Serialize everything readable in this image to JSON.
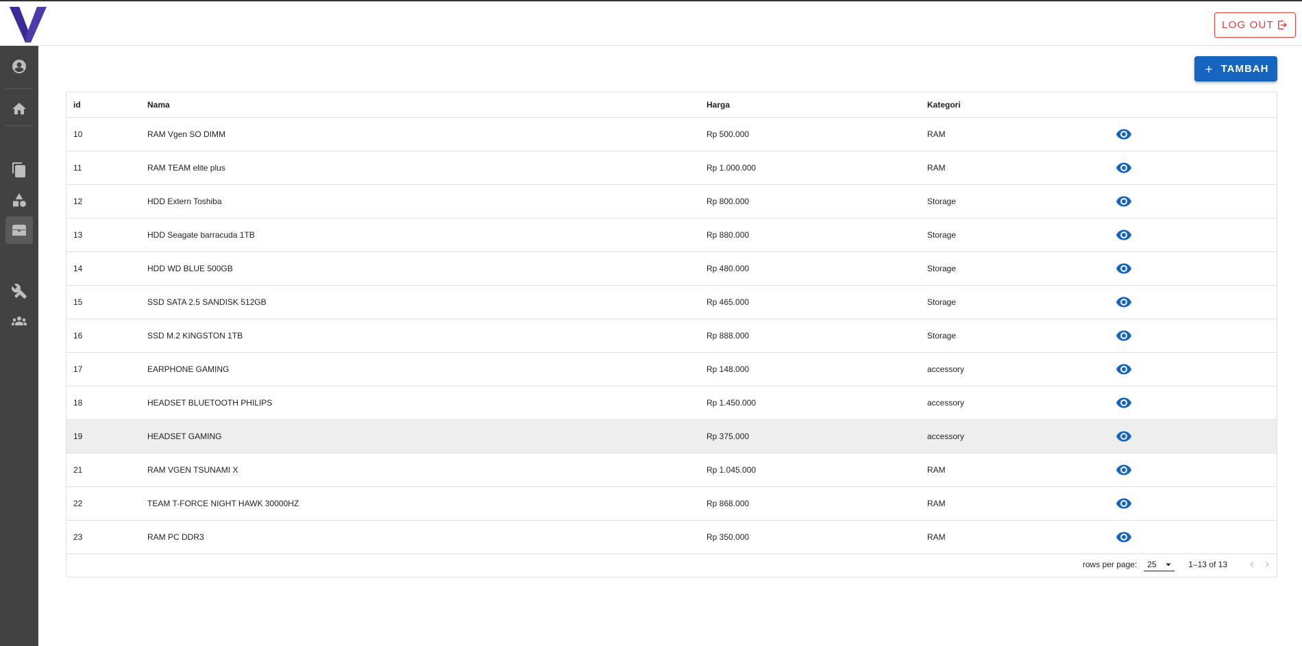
{
  "header": {
    "logout_label": "LOG OUT",
    "brand_color": "#4e3aa8",
    "logout_color": "#e53935"
  },
  "toolbar": {
    "add_label": "TAMBAH",
    "add_color": "#1565c0"
  },
  "sidebar": {
    "items": [
      {
        "icon": "account-circle-icon"
      },
      {
        "icon": "home-icon"
      },
      {
        "icon": "file-document-icon"
      },
      {
        "icon": "shapes-icon"
      },
      {
        "icon": "treasure-chest-icon",
        "active": true
      },
      {
        "icon": "tools-icon"
      },
      {
        "icon": "account-group-icon"
      }
    ]
  },
  "table": {
    "headers": [
      "id",
      "Nama",
      "Harga",
      "Kategori",
      ""
    ],
    "rows": [
      {
        "id": "10",
        "nama": "RAM Vgen SO DIMM",
        "harga": "Rp 500.000",
        "kategori": "RAM"
      },
      {
        "id": "11",
        "nama": "RAM TEAM elite plus",
        "harga": "Rp 1.000.000",
        "kategori": "RAM"
      },
      {
        "id": "12",
        "nama": "HDD Extern Toshiba",
        "harga": "Rp 800.000",
        "kategori": "Storage"
      },
      {
        "id": "13",
        "nama": "HDD Seagate barracuda 1TB",
        "harga": "Rp 880.000",
        "kategori": "Storage"
      },
      {
        "id": "14",
        "nama": "HDD WD BLUE 500GB",
        "harga": "Rp 480.000",
        "kategori": "Storage"
      },
      {
        "id": "15",
        "nama": "SSD SATA 2.5 SANDISK 512GB",
        "harga": "Rp 465.000",
        "kategori": "Storage"
      },
      {
        "id": "16",
        "nama": "SSD M.2 KINGSTON 1TB",
        "harga": "Rp 888.000",
        "kategori": "Storage"
      },
      {
        "id": "17",
        "nama": "EARPHONE GAMING",
        "harga": "Rp 148.000",
        "kategori": "accessory"
      },
      {
        "id": "18",
        "nama": "HEADSET BLUETOOTH PHILIPS",
        "harga": "Rp 1.450.000",
        "kategori": "accessory"
      },
      {
        "id": "19",
        "nama": "HEADSET GAMING",
        "harga": "Rp 375.000",
        "kategori": "accessory",
        "highlighted": true
      },
      {
        "id": "21",
        "nama": "RAM VGEN TSUNAMI X",
        "harga": "Rp 1.045.000",
        "kategori": "RAM"
      },
      {
        "id": "22",
        "nama": "TEAM T-FORCE NIGHT HAWK 30000HZ",
        "harga": "Rp 868.000",
        "kategori": "RAM"
      },
      {
        "id": "23",
        "nama": "RAM PC DDR3",
        "harga": "Rp 350.000",
        "kategori": "RAM"
      }
    ]
  },
  "pagination": {
    "rows_per_page_label": "rows per page:",
    "rows_per_page_value": "25",
    "range_text": "1–13 of 13"
  }
}
